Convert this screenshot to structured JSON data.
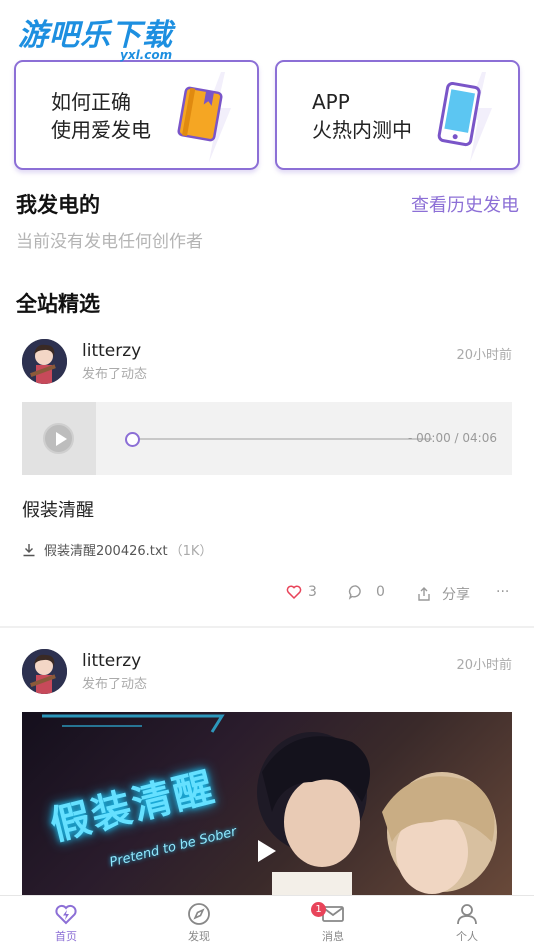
{
  "watermark": {
    "title": "游吧乐下载",
    "sub": "yxl.com"
  },
  "cards": [
    {
      "line1": "如何正确",
      "line2": "使用爱发电",
      "icon": "book-icon"
    },
    {
      "line1": "APP",
      "line2": "火热内测中",
      "icon": "phone-icon"
    }
  ],
  "my_power": {
    "title": "我发电的",
    "history_link": "查看历史发电",
    "empty": "当前没有发电任何创作者"
  },
  "featured": {
    "title": "全站精选"
  },
  "posts": [
    {
      "author": "litterzy",
      "action": "发布了动态",
      "time": "20小时前",
      "audio_time": "- 00:00 / 04:06",
      "text": "假装清醒",
      "attachment_name": "假装清醒200426.txt",
      "attachment_size": "（1K）",
      "likes": "3",
      "comments": "0",
      "share_label": "分享",
      "more": "···"
    },
    {
      "author": "litterzy",
      "action": "发布了动态",
      "time": "20小时前",
      "cover_title": "假装清醒",
      "cover_sub": "Pretend to be Sober"
    }
  ],
  "tabs": [
    {
      "label": "首页",
      "icon": "home-bolt-icon",
      "active": true
    },
    {
      "label": "发现",
      "icon": "compass-icon"
    },
    {
      "label": "消息",
      "icon": "mail-icon",
      "badge": "1"
    },
    {
      "label": "个人",
      "icon": "person-icon"
    }
  ],
  "colors": {
    "accent": "#8c6fd6",
    "badge": "#e8445a",
    "muted": "#aaaaaa"
  }
}
